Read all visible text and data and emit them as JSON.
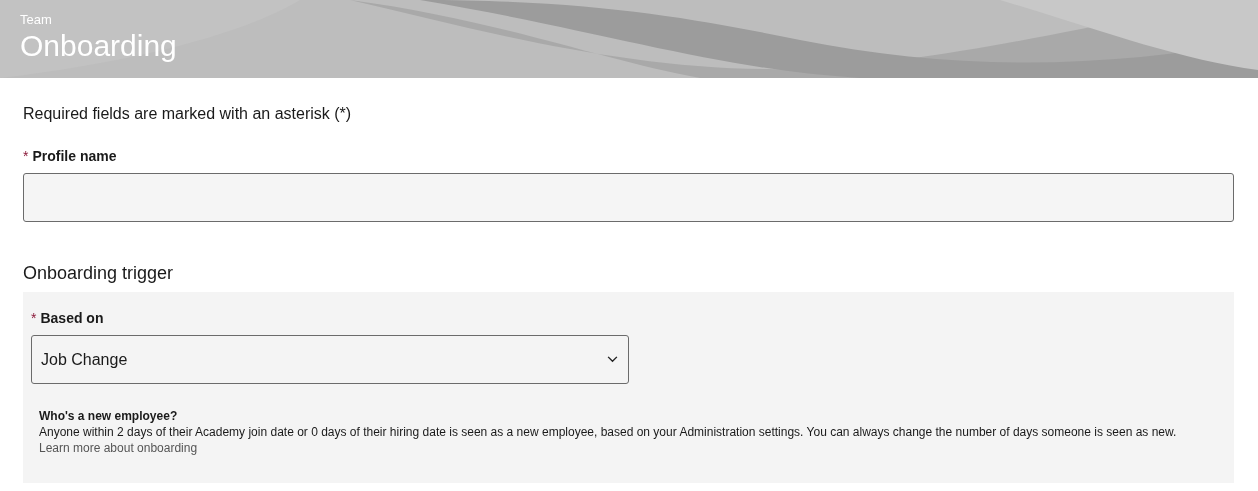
{
  "header": {
    "eyebrow": "Team",
    "title": "Onboarding"
  },
  "required_note": "Required fields are marked with an asterisk (*)",
  "profile_name": {
    "label": "Profile name",
    "required_mark": "*"
  },
  "trigger": {
    "heading": "Onboarding trigger",
    "based_on": {
      "label": "Based on",
      "required_mark": "*",
      "value": "Job Change"
    },
    "info": {
      "title": "Who's a new employee?",
      "text": "Anyone within 2 days of their Academy join date or 0 days of their hiring date is seen as a new employee, based on your Administration settings. You can always change the number of days someone is seen as new.",
      "link": "Learn more about onboarding"
    }
  }
}
